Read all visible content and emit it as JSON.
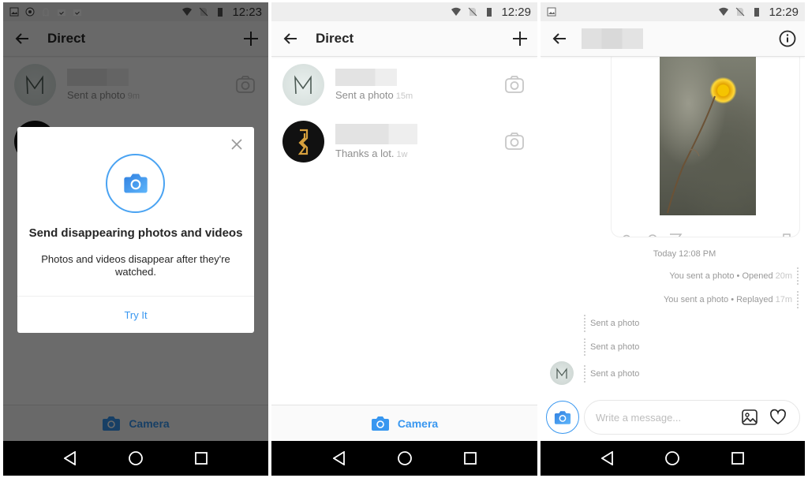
{
  "panels": [
    {
      "status_time": "12:23",
      "header_title": "Direct",
      "threads": [
        {
          "preview": "Sent a photo",
          "ago": "9m"
        }
      ],
      "dialog": {
        "heading": "Send disappearing photos and videos",
        "body": "Photos and videos disappear after they're watched.",
        "action": "Try It"
      },
      "bottom_label": "Camera"
    },
    {
      "status_time": "12:29",
      "header_title": "Direct",
      "threads": [
        {
          "preview": "Sent a photo",
          "ago": "15m"
        },
        {
          "preview": "Thanks a lot.",
          "ago": "1w"
        }
      ],
      "bottom_label": "Camera"
    },
    {
      "status_time": "12:29",
      "chat_time": "Today 12:08 PM",
      "sent_messages": [
        {
          "text": "You sent a photo • Opened",
          "ago": "20m"
        },
        {
          "text": "You sent a photo • Replayed",
          "ago": "17m"
        }
      ],
      "received_messages": [
        {
          "text": "Sent a photo"
        },
        {
          "text": "Sent a photo"
        },
        {
          "text": "Sent a photo"
        }
      ],
      "composer_placeholder": "Write a message..."
    }
  ],
  "colors": {
    "accent": "#3897f0",
    "text_primary": "#262626",
    "text_secondary": "#8e8e8e",
    "overlay": "#000000"
  }
}
